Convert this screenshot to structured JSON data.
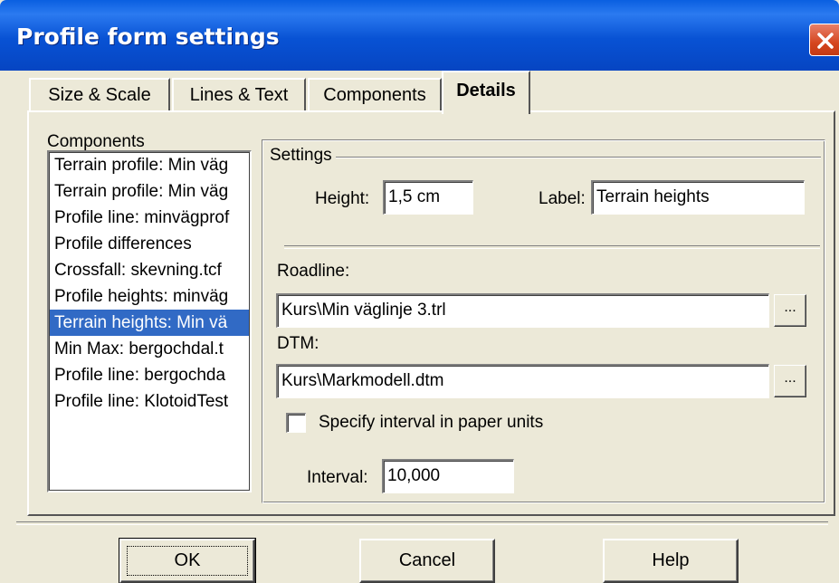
{
  "window": {
    "title": "Profile form settings"
  },
  "tabs": [
    {
      "label": "Size & Scale"
    },
    {
      "label": "Lines & Text"
    },
    {
      "label": "Components"
    },
    {
      "label": "Details",
      "active": true
    }
  ],
  "components": {
    "label": "Components",
    "items": [
      "Terrain profile: Min väg",
      "Terrain profile: Min väg",
      "Profile line: minvägprof",
      "Profile differences",
      "Crossfall: skevning.tcf",
      "Profile heights: minväg",
      "Terrain heights: Min vä",
      "Min Max: bergochdal.t",
      "Profile line: bergochda",
      "Profile line: KlotoidTest"
    ],
    "selected_index": 6
  },
  "settings": {
    "group_label": "Settings",
    "height_label": "Height:",
    "height_value": "1,5 cm",
    "label_label": "Label:",
    "label_value": "Terrain heights",
    "roadline_label": "Roadline:",
    "roadline_value": "Kurs\\Min väglinje 3.trl",
    "dtm_label": "DTM:",
    "dtm_value": "Kurs\\Markmodell.dtm",
    "browse_label": "...",
    "paper_units_label": "Specify interval in paper units",
    "paper_units_checked": false,
    "interval_label": "Interval:",
    "interval_value": "10,000"
  },
  "buttons": {
    "ok": "OK",
    "cancel": "Cancel",
    "help": "Help"
  },
  "colors": {
    "title_bar": "#0a5fe0",
    "close": "#d5461f",
    "selection": "#316ac5",
    "face": "#ece9d8"
  }
}
